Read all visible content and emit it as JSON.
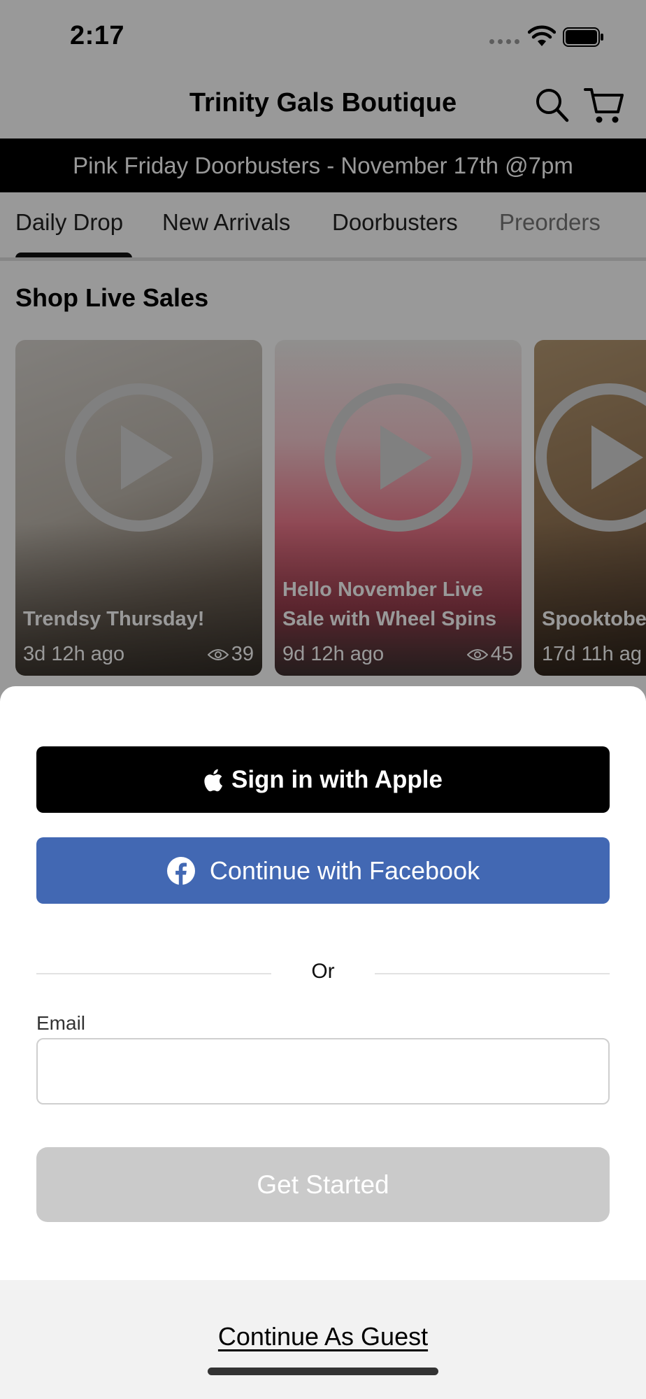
{
  "status_bar": {
    "time": "2:17"
  },
  "header": {
    "title": "Trinity Gals Boutique",
    "search_icon": "search-icon",
    "cart_icon": "cart-icon"
  },
  "banner": {
    "text": "Pink Friday Doorbusters - November 17th @7pm"
  },
  "tabs": [
    {
      "label": "Daily Drop",
      "active": true
    },
    {
      "label": "New Arrivals",
      "active": false
    },
    {
      "label": "Doorbusters",
      "active": false
    },
    {
      "label": "Preorders",
      "active": false
    }
  ],
  "live_sales": {
    "heading": "Shop Live Sales",
    "cards": [
      {
        "title": "Trendsy Thursday!",
        "ago": "3d 12h ago",
        "views": "39"
      },
      {
        "title": "Hello November Live Sale with Wheel Spins",
        "ago": "9d 12h ago",
        "views": "45"
      },
      {
        "title": "Spooktobe",
        "ago": "17d 11h ag",
        "views": ""
      }
    ]
  },
  "sign_in": {
    "apple_label": "Sign in with Apple",
    "facebook_label": "Continue with Facebook",
    "or_label": "Or",
    "email_label": "Email",
    "email_value": "",
    "get_started_label": "Get Started",
    "guest_label": "Continue As Guest"
  },
  "colors": {
    "facebook_blue": "#4268b3",
    "apple_black": "#000000",
    "disabled_gray": "#cacaca",
    "banner_black": "#000000"
  }
}
